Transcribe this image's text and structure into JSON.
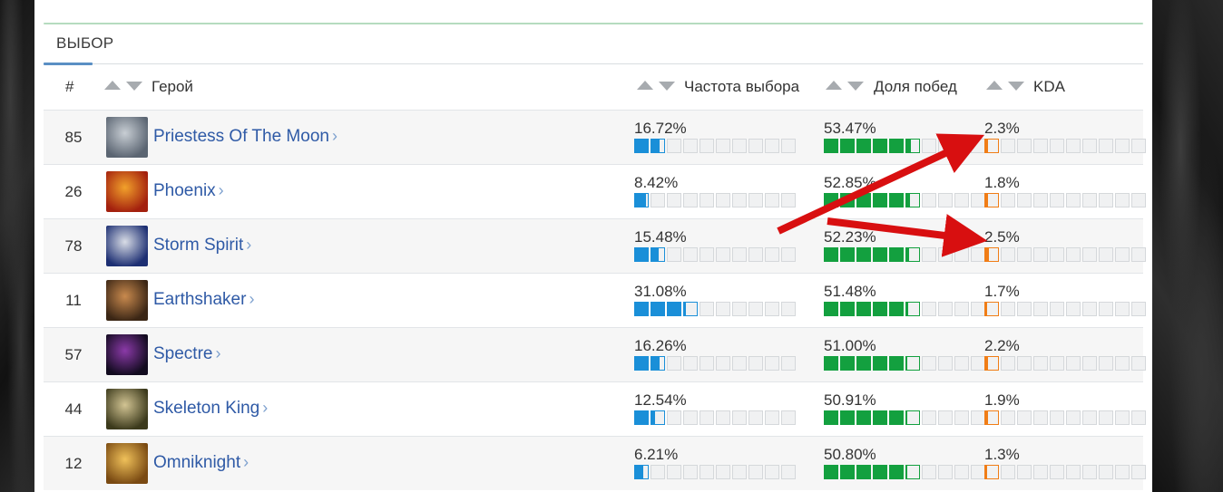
{
  "section": {
    "title": "ВЫБОР"
  },
  "headers": {
    "rank": "#",
    "hero": "Герой",
    "pick_rate": "Частота выбора",
    "win_rate": "Доля побед",
    "kda": "KDA"
  },
  "colors": {
    "pick": "#1a8fd8",
    "win": "#13a03f",
    "kda": "#f07d16",
    "link": "#2f5aa6",
    "arrow": "#d80f10"
  },
  "rows": [
    {
      "rank": "85",
      "hero": "Priestess Of The Moon",
      "pick": "16.72%",
      "win": "53.47%",
      "kda": "2.3%",
      "pick_fill": 0.1672,
      "win_fill": 0.5347,
      "kda_fill": 0.023,
      "avatar_icon": "priestess-of-the-moon-portrait",
      "avatar_colors": [
        "#c8ced4",
        "#5b6572"
      ]
    },
    {
      "rank": "26",
      "hero": "Phoenix",
      "pick": "8.42%",
      "win": "52.85%",
      "kda": "1.8%",
      "pick_fill": 0.0842,
      "win_fill": 0.5285,
      "kda_fill": 0.018,
      "avatar_icon": "phoenix-portrait",
      "avatar_colors": [
        "#f2a12b",
        "#a3200e"
      ]
    },
    {
      "rank": "78",
      "hero": "Storm Spirit",
      "pick": "15.48%",
      "win": "52.23%",
      "kda": "2.5%",
      "pick_fill": 0.1548,
      "win_fill": 0.5223,
      "kda_fill": 0.025,
      "avatar_icon": "storm-spirit-portrait",
      "avatar_colors": [
        "#d9dde6",
        "#1d2f73"
      ]
    },
    {
      "rank": "11",
      "hero": "Earthshaker",
      "pick": "31.08%",
      "win": "51.48%",
      "kda": "1.7%",
      "pick_fill": 0.3108,
      "win_fill": 0.5148,
      "kda_fill": 0.017,
      "avatar_icon": "earthshaker-portrait",
      "avatar_colors": [
        "#c98a4e",
        "#3b2615"
      ]
    },
    {
      "rank": "57",
      "hero": "Spectre",
      "pick": "16.26%",
      "win": "51.00%",
      "kda": "2.2%",
      "pick_fill": 0.1626,
      "win_fill": 0.51,
      "kda_fill": 0.022,
      "avatar_icon": "spectre-portrait",
      "avatar_colors": [
        "#8b3aa8",
        "#120b1f"
      ]
    },
    {
      "rank": "44",
      "hero": "Skeleton King",
      "pick": "12.54%",
      "win": "50.91%",
      "kda": "1.9%",
      "pick_fill": 0.1254,
      "win_fill": 0.5091,
      "kda_fill": 0.019,
      "avatar_icon": "skeleton-king-portrait",
      "avatar_colors": [
        "#d2c493",
        "#3c3a1c"
      ]
    },
    {
      "rank": "12",
      "hero": "Omniknight",
      "pick": "6.21%",
      "win": "50.80%",
      "kda": "1.3%",
      "pick_fill": 0.0621,
      "win_fill": 0.508,
      "kda_fill": 0.013,
      "avatar_icon": "omniknight-portrait",
      "avatar_colors": [
        "#f0c15a",
        "#7a4a12"
      ]
    }
  ]
}
